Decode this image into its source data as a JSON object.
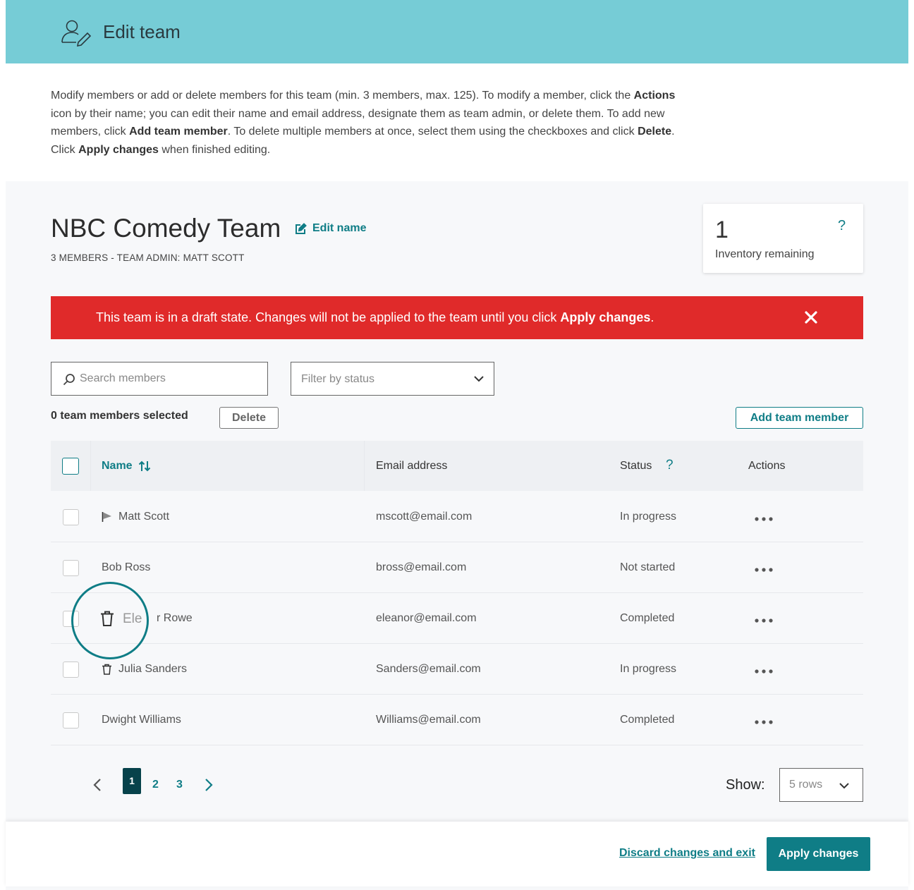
{
  "header": {
    "title": "Edit team",
    "icon": "user-edit-icon"
  },
  "intro": {
    "p1": "Modify members or add or delete members for this team (min. 3 members, max. 125). To modify a member, click the ",
    "b1": "Actions",
    "p2": " icon by their name; you can edit their name and email address, designate them as team admin, or delete them. To add new members, click ",
    "b2": "Add team member",
    "p3": ". To delete multiple members at once, select them using the checkboxes and click ",
    "b3": "Delete",
    "p4": ". Click ",
    "b4": "Apply changes",
    "p5": " when finished editing."
  },
  "team": {
    "name": "NBC Comedy Team",
    "edit_name_label": "Edit name",
    "subtitle": "3 MEMBERS - TEAM ADMIN: MATT SCOTT"
  },
  "inventory": {
    "count": "1",
    "label": "Inventory remaining",
    "help": "?"
  },
  "alert": {
    "message": "This team is in a draft state. Changes will not be applied to the team until you click ",
    "bold": "Apply changes",
    "suffix": ".",
    "color": "#e02a2a"
  },
  "search": {
    "placeholder": "Search members",
    "value": ""
  },
  "filter": {
    "placeholder": "Filter by status"
  },
  "toolbar": {
    "selected_count": "0 team members selected",
    "delete_label": "Delete",
    "add_label": "Add team member"
  },
  "table": {
    "headers": {
      "name": "Name",
      "email": "Email address",
      "status": "Status",
      "status_help": "?",
      "actions": "Actions"
    },
    "rows": [
      {
        "name": "Matt Scott",
        "email": "mscott@email.com",
        "status": "In progress",
        "icon": "flag-icon"
      },
      {
        "name": "Bob Ross",
        "email": "bross@email.com",
        "status": "Not started",
        "icon": ""
      },
      {
        "name": "Eleanor Rowe",
        "email": "eleanor@email.com",
        "status": "Completed",
        "icon": ""
      },
      {
        "name": "Julia Sanders",
        "email": "Sanders@email.com",
        "status": "In progress",
        "icon": "trash-icon"
      },
      {
        "name": "Dwight Williams",
        "email": "Williams@email.com",
        "status": "Completed",
        "icon": ""
      }
    ]
  },
  "drag": {
    "ghost_text": "Ele",
    "visible_suffix": "r Rowe"
  },
  "pagination": {
    "pages": [
      "1",
      "2",
      "3"
    ],
    "current": "1"
  },
  "rows_per_page": {
    "label": "Show:",
    "value": "5 rows"
  },
  "footer": {
    "discard_label": "Discard changes and exit",
    "apply_label": "Apply changes"
  },
  "colors": {
    "accent": "#0f7d86",
    "header_bg": "#76ccd6",
    "alert": "#e02a2a",
    "page_active": "#07424b"
  }
}
